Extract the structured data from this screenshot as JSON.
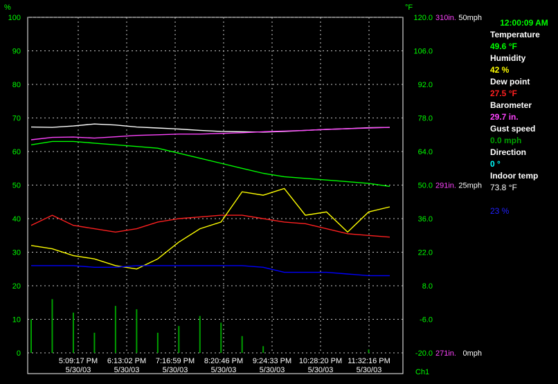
{
  "chart_data": {
    "type": "line",
    "left_axis_unit": "%",
    "left_ticks": [
      "100",
      "90",
      "80",
      "70",
      "60",
      "50",
      "40",
      "30",
      "20",
      "10",
      "0"
    ],
    "right_axis_unit": "°F",
    "right_temp_ticks": [
      "120.0",
      "106.0",
      "92.0",
      "78.0",
      "64.0",
      "50.0",
      "36.0",
      "22.0",
      "8.0",
      "-6.0",
      "-20.0"
    ],
    "right_baro_ticks": [
      "310in.",
      "291in.",
      "271in."
    ],
    "right_wind_ticks": [
      "50mph",
      "25mph",
      "0mph"
    ],
    "channel_label": "Ch1",
    "x_ticks": [
      {
        "time": "5:09:17 PM",
        "date": "5/30/03"
      },
      {
        "time": "6:13:02 PM",
        "date": "5/30/03"
      },
      {
        "time": "7:16:59 PM",
        "date": "5/30/03"
      },
      {
        "time": "8:20:46 PM",
        "date": "5/30/03"
      },
      {
        "time": "9:24:33 PM",
        "date": "5/30/03"
      },
      {
        "time": "10:28:20 PM",
        "date": "5/30/03"
      },
      {
        "time": "11:32:16 PM",
        "date": "5/30/03"
      }
    ],
    "ylim": [
      0,
      100
    ],
    "grid": true,
    "series": [
      {
        "key": "barometer_white",
        "color": "#ffffff",
        "values": [
          67.3,
          67.2,
          67.6,
          68.2,
          67.9,
          67.3,
          67.0,
          66.7,
          66.3,
          66.0,
          65.9,
          65.8,
          66.0,
          66.3,
          66.6,
          66.8,
          67.1,
          67.2
        ]
      },
      {
        "key": "barometer",
        "color": "#ff44ff",
        "values": [
          63.5,
          64.2,
          64.3,
          64.0,
          64.4,
          64.8,
          65.0,
          65.2,
          65.2,
          65.4,
          65.6,
          65.9,
          66.1,
          66.3,
          66.6,
          66.8,
          67.0,
          67.2
        ]
      },
      {
        "key": "temperature",
        "color": "#00ff00",
        "values": [
          62.0,
          63.0,
          63.0,
          62.5,
          62.0,
          61.5,
          61.0,
          59.5,
          58.0,
          56.5,
          55.0,
          53.5,
          52.5,
          52.0,
          51.5,
          51.0,
          50.5,
          49.6
        ]
      },
      {
        "key": "dew_point",
        "color": "#ff2020",
        "values": [
          38.0,
          41.0,
          38.0,
          37.0,
          36.0,
          37.0,
          39.0,
          40.0,
          40.5,
          41.0,
          41.0,
          40.0,
          39.0,
          38.5,
          37.0,
          35.5,
          35.0,
          34.5
        ]
      },
      {
        "key": "humidity",
        "color": "#ffff00",
        "values": [
          32.0,
          31.0,
          29.0,
          28.0,
          26.0,
          25.0,
          28.0,
          33.0,
          37.0,
          39.0,
          48.0,
          47.0,
          49.0,
          41.0,
          42.0,
          36.0,
          42.0,
          43.5
        ]
      },
      {
        "key": "indoor_temp",
        "color": "#0000ff",
        "values": [
          26.0,
          26.0,
          26.0,
          25.5,
          25.5,
          26.0,
          26.0,
          26.0,
          26.0,
          26.0,
          26.0,
          25.5,
          24.0,
          24.0,
          24.0,
          23.5,
          23.0,
          23.0
        ]
      },
      {
        "key": "gust_speed",
        "color": "#00a000",
        "values": [
          10,
          16,
          12,
          6,
          14,
          13,
          6,
          8,
          11,
          9,
          5,
          2,
          0,
          0,
          0,
          0,
          1,
          0
        ]
      }
    ]
  },
  "panel": {
    "time": "12:00:09 AM",
    "temperature_label": "Temperature",
    "temperature_value": "49.6 °F",
    "humidity_label": "Humidity",
    "humidity_value": "42 %",
    "dew_point_label": "Dew point",
    "dew_point_value": "27.5 °F",
    "barometer_label": "Barometer",
    "barometer_value": "29.7 in.",
    "gust_label": "Gust speed",
    "gust_value": "0.0 mph",
    "direction_label": "Direction",
    "direction_value": "0 °",
    "indoor_label": "Indoor temp",
    "indoor_value": "73.8 °F",
    "indoor_hum_value": "23 %"
  },
  "colors": {
    "temperature": "#00ff00",
    "humidity": "#ffff00",
    "dew_point": "#ff2020",
    "barometer": "#ff44ff",
    "gust": "#00a000",
    "direction": "#00ffff",
    "indoor": "#ffffff",
    "indoor_hum": "#2020ff"
  }
}
